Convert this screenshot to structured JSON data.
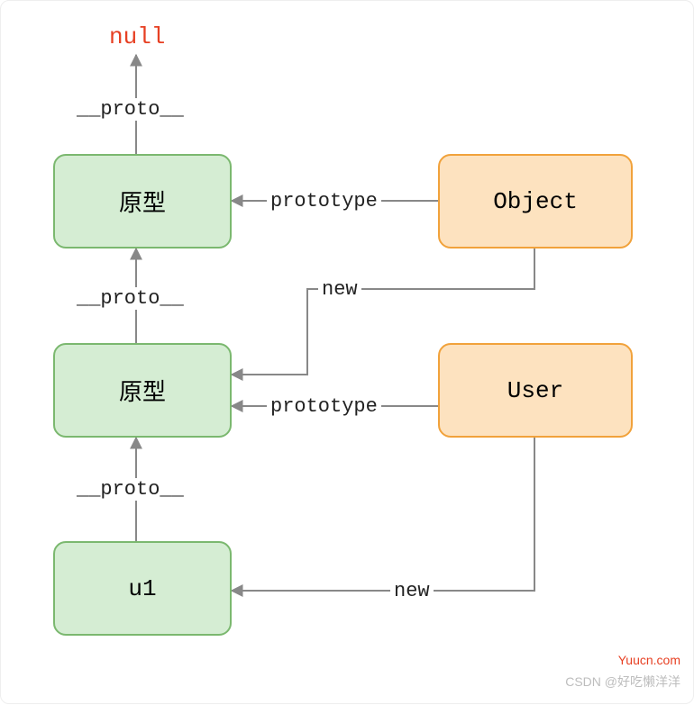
{
  "nodes": {
    "null": "null",
    "proto1": "原型",
    "proto2": "原型",
    "u1": "u1",
    "object": "Object",
    "user": "User"
  },
  "edges": {
    "proto_up1": "__proto__",
    "proto_up2": "__proto__",
    "proto_up3": "__proto__",
    "prototype1": "prototype",
    "prototype2": "prototype",
    "new1": "new",
    "new2": "new"
  },
  "watermarks": {
    "site": "Yuucn.com",
    "csdn": "CSDN @好吃懒洋洋"
  },
  "colors": {
    "arrow": "#888888",
    "greenFill": "#d5edd3",
    "greenStroke": "#7bb86f",
    "orangeFill": "#fde2bf",
    "orangeStroke": "#f1a23b",
    "nullColor": "#e74023"
  }
}
